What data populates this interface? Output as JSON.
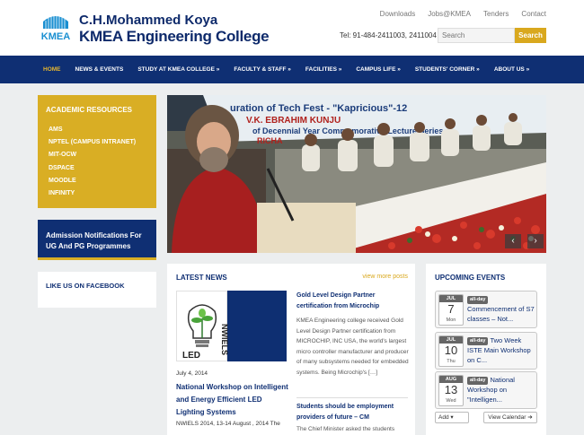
{
  "header": {
    "logo_text": "KMEA",
    "college_prefix": "C.H.Mohammed Koya",
    "college_name": "KMEA Engineering College",
    "top_links": [
      "Downloads",
      "Jobs@KMEA",
      "Tenders",
      "Contact"
    ],
    "tel": "Tel:  91-484-2411003, 2411004",
    "search_placeholder": "Search",
    "search_button": "Search"
  },
  "nav": {
    "items": [
      "HOME",
      "NEWS & EVENTS",
      "STUDY AT KMEA COLLEGE »",
      "FACULTY & STAFF »",
      "FACILITIES »",
      "CAMPUS LIFE »",
      "STUDENTS' CORNER »",
      "ABOUT US »"
    ]
  },
  "sidebar": {
    "resources_title": "ACADEMIC RESOURCES",
    "resources": [
      "AMS",
      "NPTEL (CAMPUS INTRANET)",
      "MIT-OCW",
      "DSPACE",
      "MOODLE",
      "INFINITY"
    ],
    "admission": "Admission Notifications For UG And PG Programmes",
    "facebook": "LIKE US ON FACEBOOK"
  },
  "slider": {
    "banner_line1": "uration of Tech Fest - \"Kapricious\"-12",
    "banner_line2": "V.K. EBRAHIM KUNJU",
    "banner_line3": "of Decennial Year Commemorative Lecture Series",
    "banner_line4": "RICHA",
    "prev": "‹",
    "next": "›"
  },
  "news": {
    "title": "LATEST NEWS",
    "more": "view more posts",
    "thumb_label": "NWIELS",
    "date": "July 4, 2014",
    "headline1": "National Workshop on Intelligent and Energy Efficient LED Lighting Systems",
    "excerpt1": "NWIELS 2014, 13-14 August , 2014 The",
    "headline2": "Gold Level Design Partner certification from Microchip",
    "excerpt2": "KMEA Engineering college received Gold Level Design Partner certification from MICROCHIP, INC USA, the world's largest micro controller manufacturer and producer of many subsystems needed for embedded systems. Being Microchip's […]",
    "headline3": "Students should be employment providers of future – CM",
    "excerpt3": "The Chief Minister asked the students"
  },
  "events": {
    "title": "UPCOMING EVENTS",
    "all_day": "all-day",
    "items": [
      {
        "month": "JUL",
        "day": "7",
        "dow": "Mon",
        "text": "Commencement of S7 classes – Not..."
      },
      {
        "month": "JUL",
        "day": "10",
        "dow": "Thu",
        "text": "Two Week ISTE Main Workshop on C..."
      },
      {
        "month": "AUG",
        "day": "13",
        "dow": "Wed",
        "text": "National Workshop on \"Intelligen..."
      }
    ],
    "add_label": "Add ▾",
    "view_label": "View Calendar ➔"
  },
  "colors": {
    "navy": "#0f2f73",
    "gold": "#d9ae24",
    "bg": "#eceeef"
  }
}
